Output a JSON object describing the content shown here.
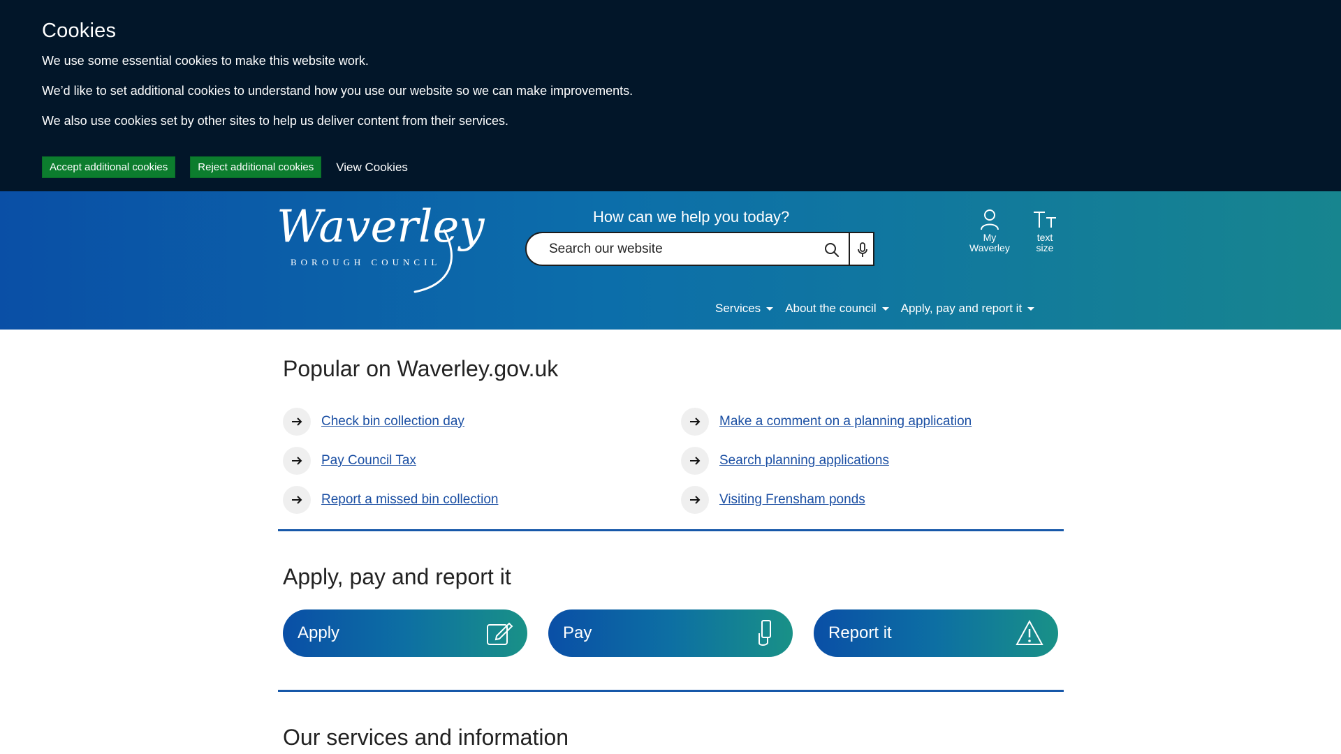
{
  "cookie": {
    "title": "Cookies",
    "line1": "We use some essential cookies to make this website work.",
    "line2": "We’d like to set additional cookies to understand how you use our website so we can make improvements.",
    "line3": "We also use cookies set by other sites to help us deliver content from their services.",
    "accept_label": "Accept additional cookies",
    "reject_label": "Reject additional cookies",
    "view_label": "View Cookies"
  },
  "header": {
    "logo_word": "Waverley",
    "logo_sub": "BOROUGH COUNCIL",
    "help_title": "How can we help you today?",
    "search_placeholder": "Search our website",
    "my_waverley_line1": "My",
    "my_waverley_line2": "Waverley",
    "text_size_line1": "text",
    "text_size_line2": "size"
  },
  "nav": {
    "services": "Services",
    "about": "About the council",
    "apply": "Apply, pay and report it"
  },
  "popular": {
    "title": "Popular on Waverley.gov.uk",
    "left": [
      "Check bin collection day",
      "Pay Council Tax",
      "Report a missed bin collection"
    ],
    "right": [
      "Make a comment on a planning application",
      "Search planning applications",
      "Visiting Frensham ponds"
    ]
  },
  "apply_section": {
    "title": "Apply, pay and report it",
    "cards": [
      "Apply",
      "Pay",
      "Report it"
    ]
  },
  "services_section": {
    "title": "Our services and information"
  },
  "colors": {
    "banner_bg": "#021629",
    "accept_green": "#0c7d2e",
    "link_blue": "#1b4fa3",
    "header_start": "#0a4fa6",
    "header_end": "#17858f"
  }
}
